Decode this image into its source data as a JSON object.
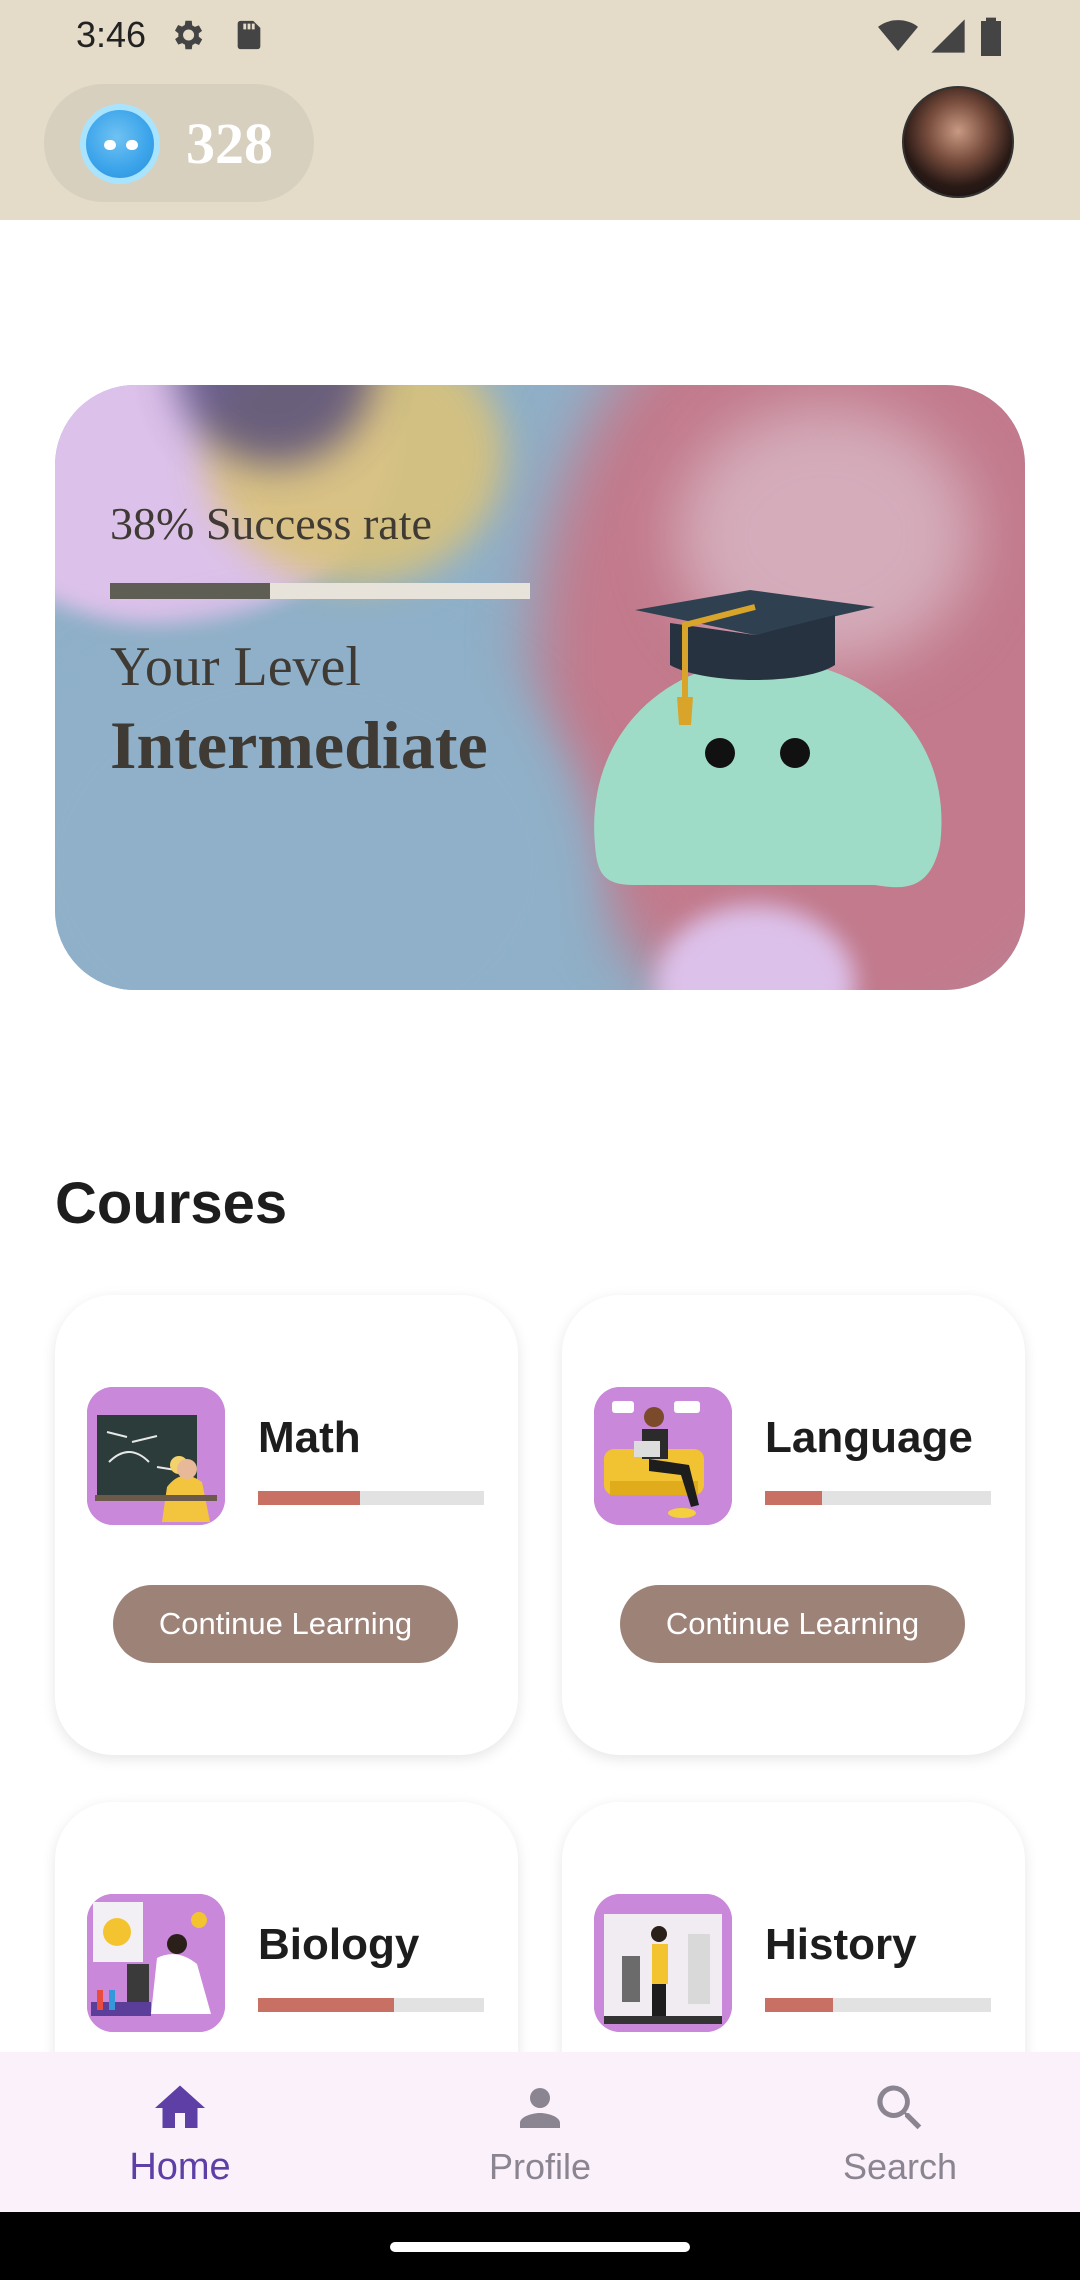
{
  "status_bar": {
    "time": "3:46"
  },
  "header": {
    "coin_count": "328"
  },
  "level_card": {
    "success_text": "38% Success rate",
    "success_rate": 0.38,
    "level_label": "Your Level",
    "level_value": "Intermediate"
  },
  "courses": {
    "title": "Courses",
    "items": [
      {
        "name": "Math",
        "progress": 0.45,
        "button_label": "Continue Learning"
      },
      {
        "name": "Language",
        "progress": 0.25,
        "button_label": "Continue Learning"
      },
      {
        "name": "Biology",
        "progress": 0.6
      },
      {
        "name": "History",
        "progress": 0.3
      }
    ]
  },
  "bottom_nav": {
    "items": [
      {
        "label": "Home",
        "icon": "home-icon",
        "active": true
      },
      {
        "label": "Profile",
        "icon": "person-icon",
        "active": false
      },
      {
        "label": "Search",
        "icon": "search-icon",
        "active": false
      }
    ]
  },
  "colors": {
    "header_bg": "#e4dcc8",
    "accent": "#5d3fa6",
    "progress_fill": "#c97065",
    "button_bg": "#9d8278",
    "mascot": "#9fdcc8"
  }
}
